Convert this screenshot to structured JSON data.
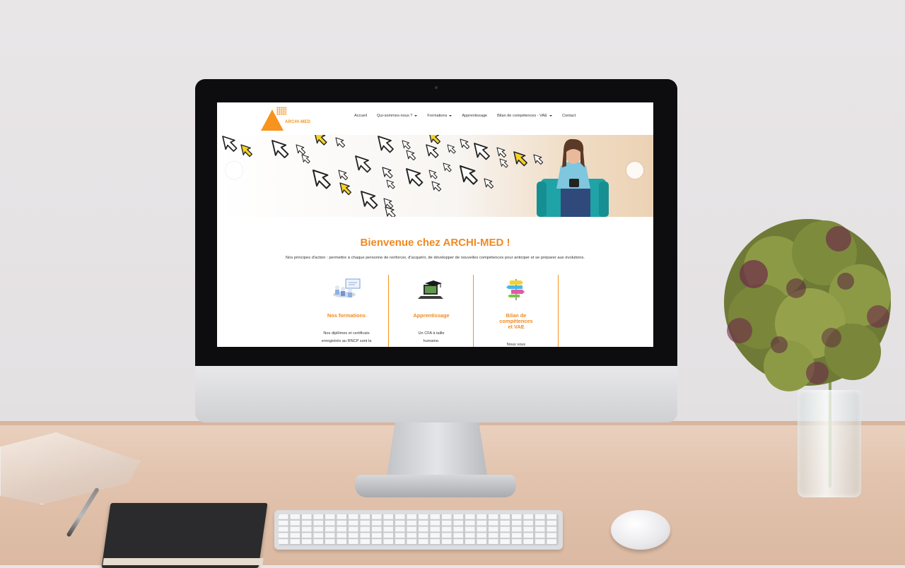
{
  "site": {
    "logo_text": "ARCHI-MED",
    "nav": [
      {
        "label": "Accueil",
        "has_dropdown": false
      },
      {
        "label": "Qui-sommes-nous ?",
        "has_dropdown": true
      },
      {
        "label": "Formations",
        "has_dropdown": true
      },
      {
        "label": "Apprentissage",
        "has_dropdown": false
      },
      {
        "label": "Bilan de compétences - VAE",
        "has_dropdown": true
      },
      {
        "label": "Contact",
        "has_dropdown": false
      }
    ],
    "welcome_title": "Bienvenue chez ARCHI-MED !",
    "principles": "Nos principes d'action : permettre à chaque personne de renforcer, d'acquérir, de développer de nouvelles compétences pour anticiper et se préparer aux évolutions.",
    "cards": [
      {
        "title": "Nos formations",
        "text_lines": [
          "Nos diplômes et certificats",
          "enregistrés au RNCP sont la"
        ],
        "icon": "presentation-icon"
      },
      {
        "title": "Apprentissage",
        "text_lines": [
          "Un CFA à taille",
          "humaine."
        ],
        "icon": "laptop-graduation-icon"
      },
      {
        "title_lines": [
          "Bilan de",
          "compétences",
          "et VAE"
        ],
        "text_lines": [
          "Nous vous"
        ],
        "icon": "signpost-icon"
      }
    ]
  },
  "colors": {
    "accent": "#f08a24",
    "logo": "#f7931e",
    "arrow_yellow": "#f5d328"
  }
}
